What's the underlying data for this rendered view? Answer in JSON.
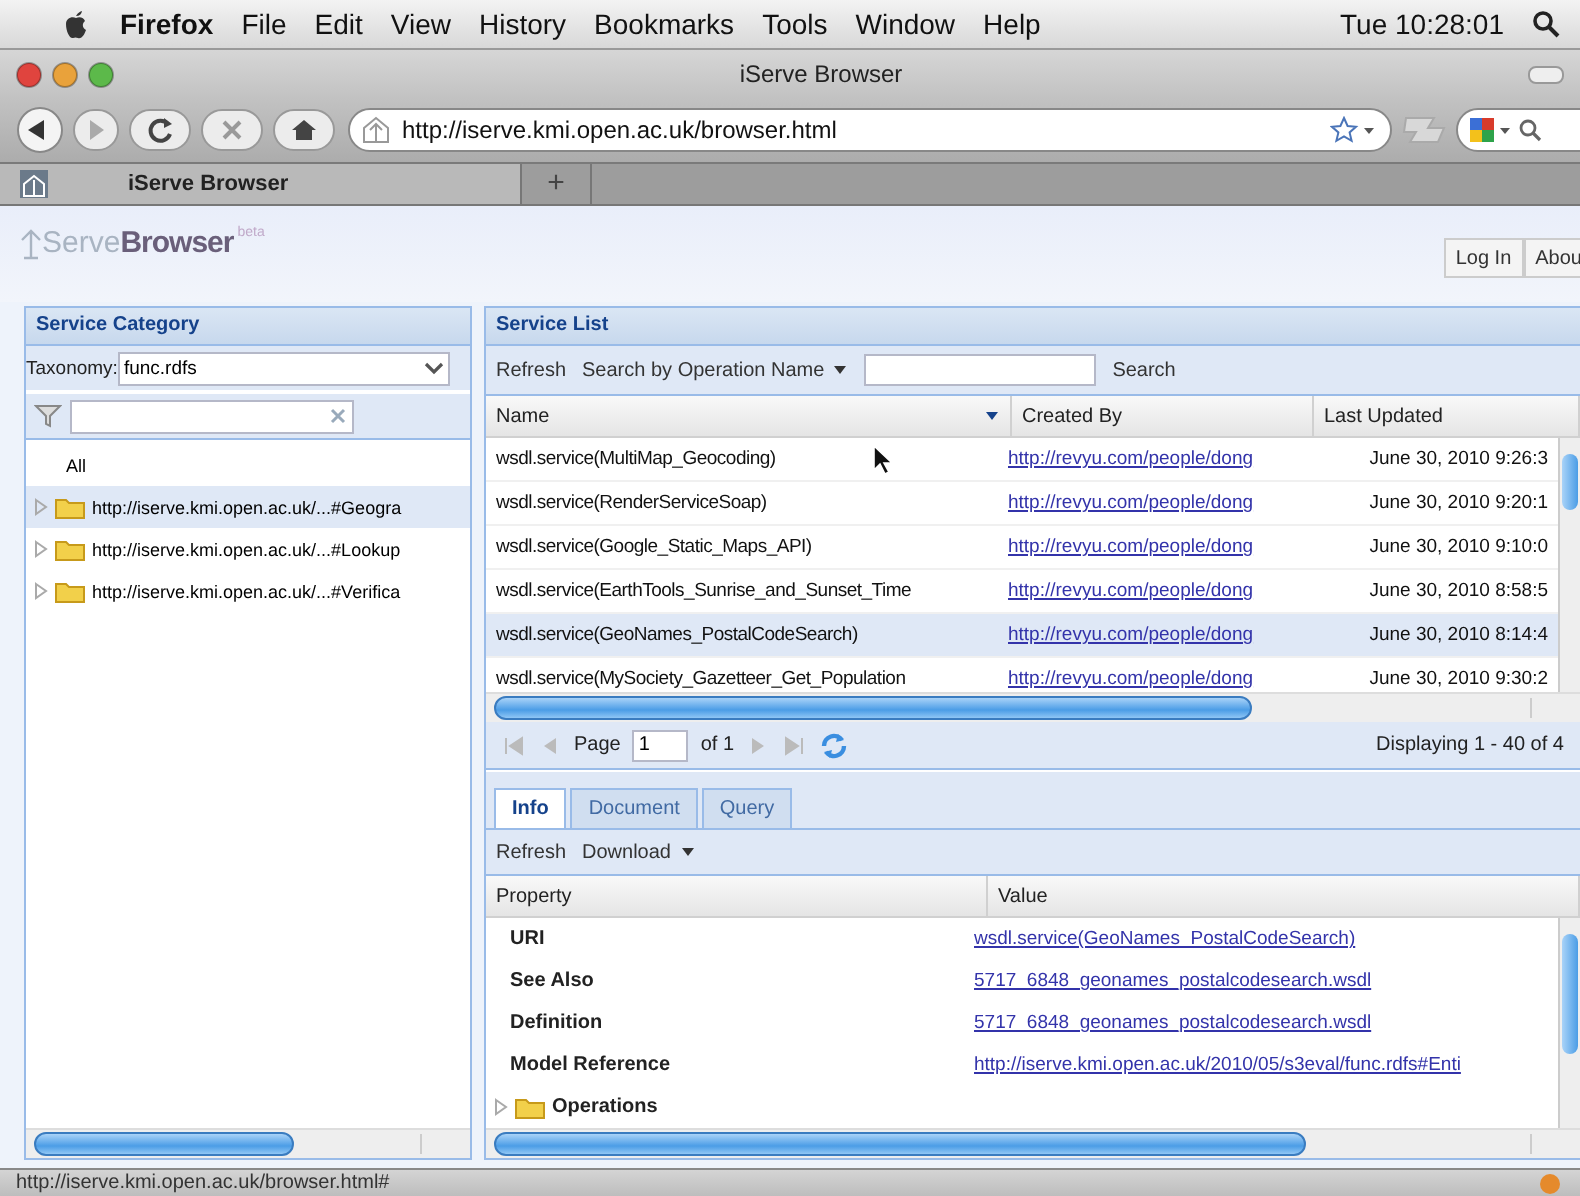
{
  "menu_bar": {
    "app": "Firefox",
    "items": [
      "File",
      "Edit",
      "View",
      "History",
      "Bookmarks",
      "Tools",
      "Window",
      "Help"
    ],
    "clock": "Tue 10:28:01"
  },
  "window": {
    "title": "iServe Browser"
  },
  "address_bar": {
    "value": "http://iserve.kmi.open.ac.uk/browser.html"
  },
  "tabs": [
    {
      "label": "iServe Browser",
      "selected": true
    }
  ],
  "new_tab": "+",
  "page_header": {
    "logo_light": "Serve",
    "logo_bold": "Browser",
    "logo_badge": "beta",
    "buttons": [
      "Log In",
      "Abou"
    ]
  },
  "category_panel": {
    "title": "Service Category",
    "taxonomy_label": "Taxonomy:",
    "taxonomy_value": "func.rdfs",
    "tree": [
      {
        "kind": "leaf",
        "label": "All",
        "selected": false
      },
      {
        "kind": "folder",
        "label": "http://iserve.kmi.open.ac.uk/...#Geogra",
        "selected": true,
        "expanded": false
      },
      {
        "kind": "folder",
        "label": "http://iserve.kmi.open.ac.uk/...#Lookup",
        "selected": false,
        "expanded": false
      },
      {
        "kind": "folder",
        "label": "http://iserve.kmi.open.ac.uk/...#Verifica",
        "selected": false,
        "expanded": false
      }
    ]
  },
  "service_list": {
    "title": "Service List",
    "refresh": "Refresh",
    "search_by": "Search by Operation Name",
    "search": "Search",
    "columns": [
      "Name",
      "Created By",
      "Last Updated"
    ],
    "rows": [
      {
        "name": "wsdl.service(MultiMap_Geocoding)",
        "created_by": "http://revyu.com/people/dong",
        "last_updated": "June 30, 2010 9:26:3",
        "selected": false
      },
      {
        "name": "wsdl.service(RenderServiceSoap)",
        "created_by": "http://revyu.com/people/dong",
        "last_updated": "June 30, 2010 9:20:1",
        "selected": false
      },
      {
        "name": "wsdl.service(Google_Static_Maps_API)",
        "created_by": "http://revyu.com/people/dong",
        "last_updated": "June 30, 2010 9:10:0",
        "selected": false
      },
      {
        "name": "wsdl.service(EarthTools_Sunrise_and_Sunset_Time",
        "created_by": "http://revyu.com/people/dong",
        "last_updated": "June 30, 2010 8:58:5",
        "selected": false
      },
      {
        "name": "wsdl.service(GeoNames_PostalCodeSearch)",
        "created_by": "http://revyu.com/people/dong",
        "last_updated": "June 30, 2010 8:14:4",
        "selected": true
      },
      {
        "name": "wsdl.service(MySociety_Gazetteer_Get_Population",
        "created_by": "http://revyu.com/people/dong",
        "last_updated": "June 30, 2010 9:30:2",
        "selected": false
      }
    ],
    "paging": {
      "page_label": "Page",
      "page": "1",
      "of": "of 1",
      "displaying": "Displaying 1 - 40 of 4"
    }
  },
  "detail_tabs": [
    {
      "label": "Info",
      "selected": true
    },
    {
      "label": "Document",
      "selected": false
    },
    {
      "label": "Query",
      "selected": false
    }
  ],
  "detail_toolbar": {
    "refresh": "Refresh",
    "download": "Download"
  },
  "properties": {
    "columns": [
      "Property",
      "Value"
    ],
    "rows": [
      {
        "kind": "link",
        "property": "URI",
        "value": "wsdl.service(GeoNames_PostalCodeSearch)"
      },
      {
        "kind": "link",
        "property": "See Also",
        "value": "5717_6848_geonames_postalcodesearch.wsdl"
      },
      {
        "kind": "link",
        "property": "Definition",
        "value": "5717_6848_geonames_postalcodesearch.wsdl"
      },
      {
        "kind": "link",
        "property": "Model Reference",
        "value": "http://iserve.kmi.open.ac.uk/2010/05/s3eval/func.rdfs#Enti"
      },
      {
        "kind": "folder",
        "property": "Operations",
        "expanded": false
      }
    ]
  },
  "status_bar": {
    "text": "http://iserve.kmi.open.ac.uk/browser.html#"
  }
}
